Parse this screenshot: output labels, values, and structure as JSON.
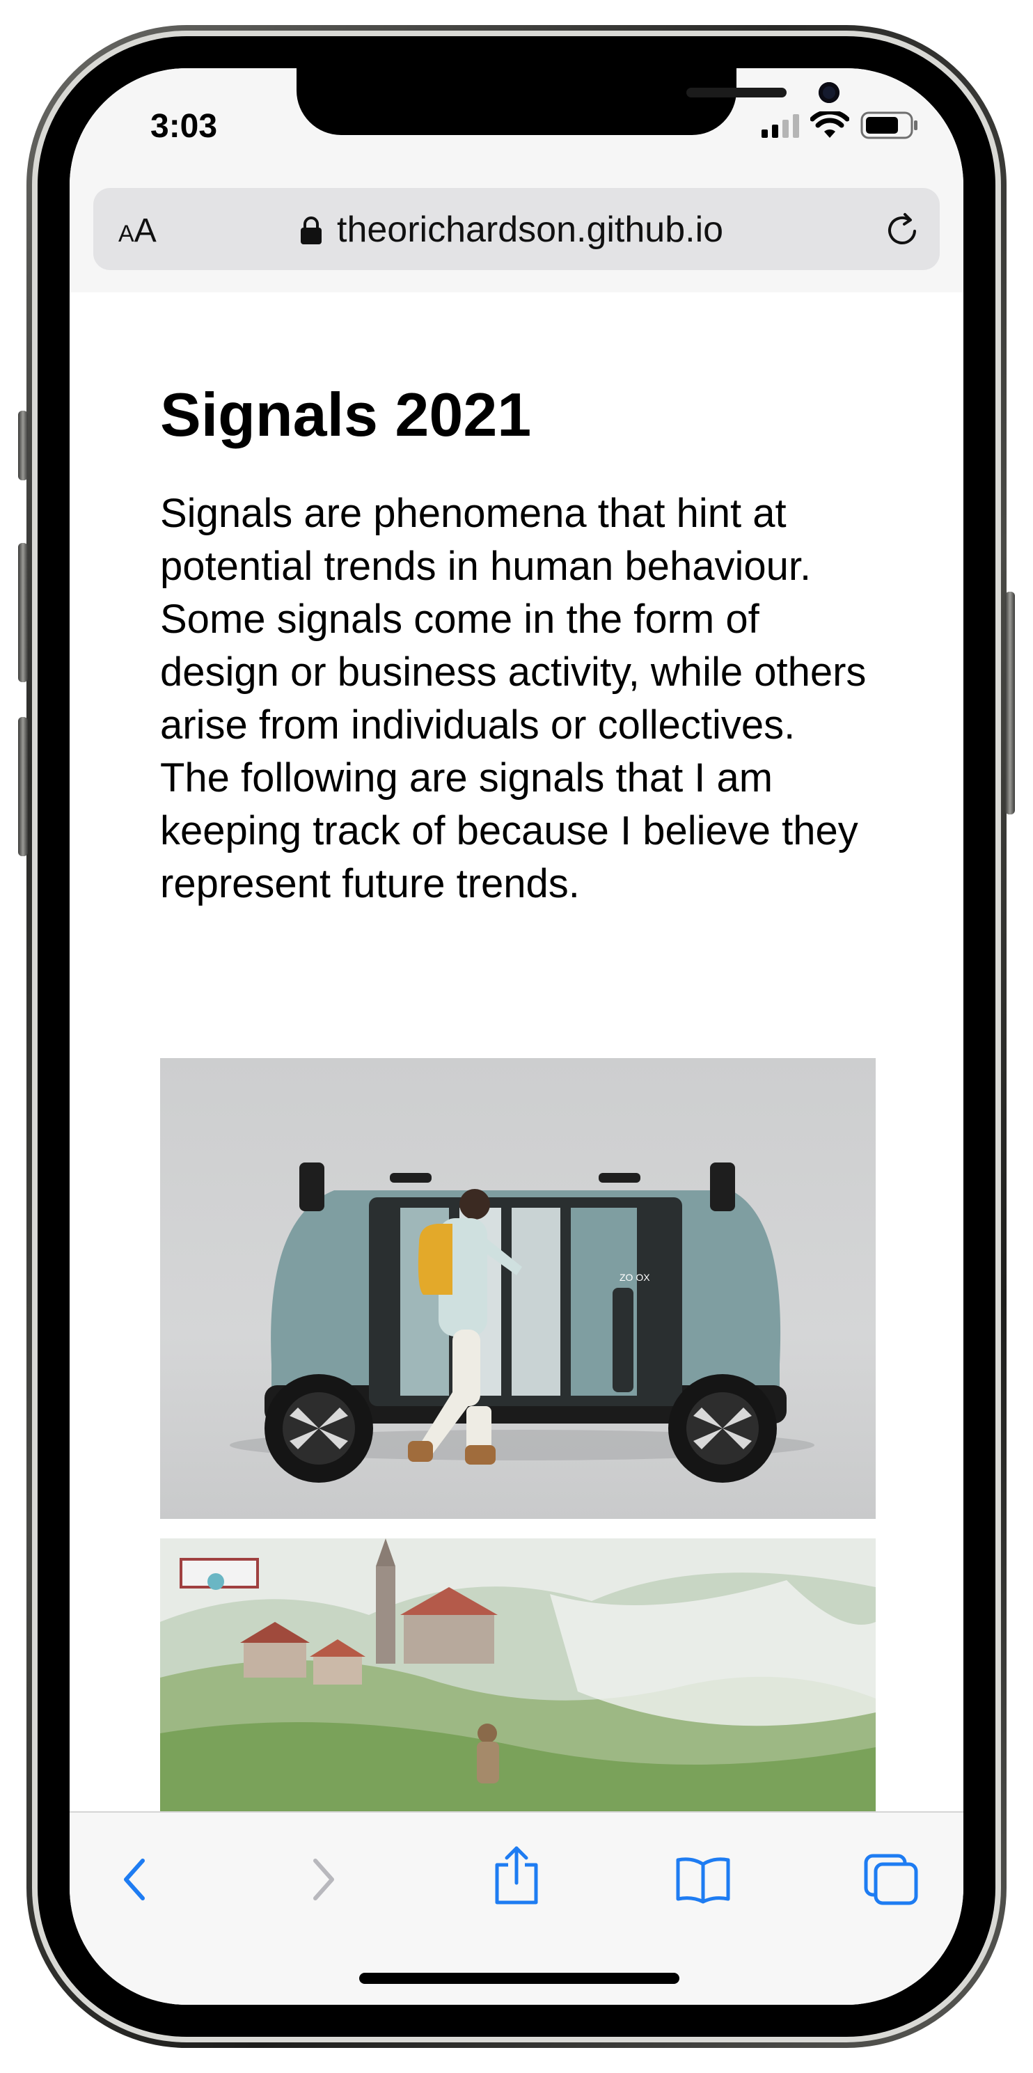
{
  "status_bar": {
    "time": "3:03"
  },
  "address_bar": {
    "text_size_label_small": "A",
    "text_size_label_large": "A",
    "url": "theorichardson.github.io"
  },
  "page": {
    "title": "Signals 2021",
    "intro": "Signals are phenomena that hint at potential trends in human behaviour. Some signals come in the form of design or business activity, while others arise from individuals or collectives. The following are signals that I am keeping track of because I believe they represent future trends.",
    "vehicle_logo_text": "ZO OX"
  },
  "icons": {
    "signal": "cellular-signal-icon",
    "wifi": "wifi-icon",
    "battery": "battery-icon",
    "lock": "lock-icon",
    "reload": "reload-icon",
    "back": "chevron-left-icon",
    "forward": "chevron-right-icon",
    "share": "share-icon",
    "bookmarks": "book-icon",
    "tabs": "tabs-icon"
  },
  "colors": {
    "accent": "#1e7cf2",
    "disabled": "#b8b8bd"
  }
}
